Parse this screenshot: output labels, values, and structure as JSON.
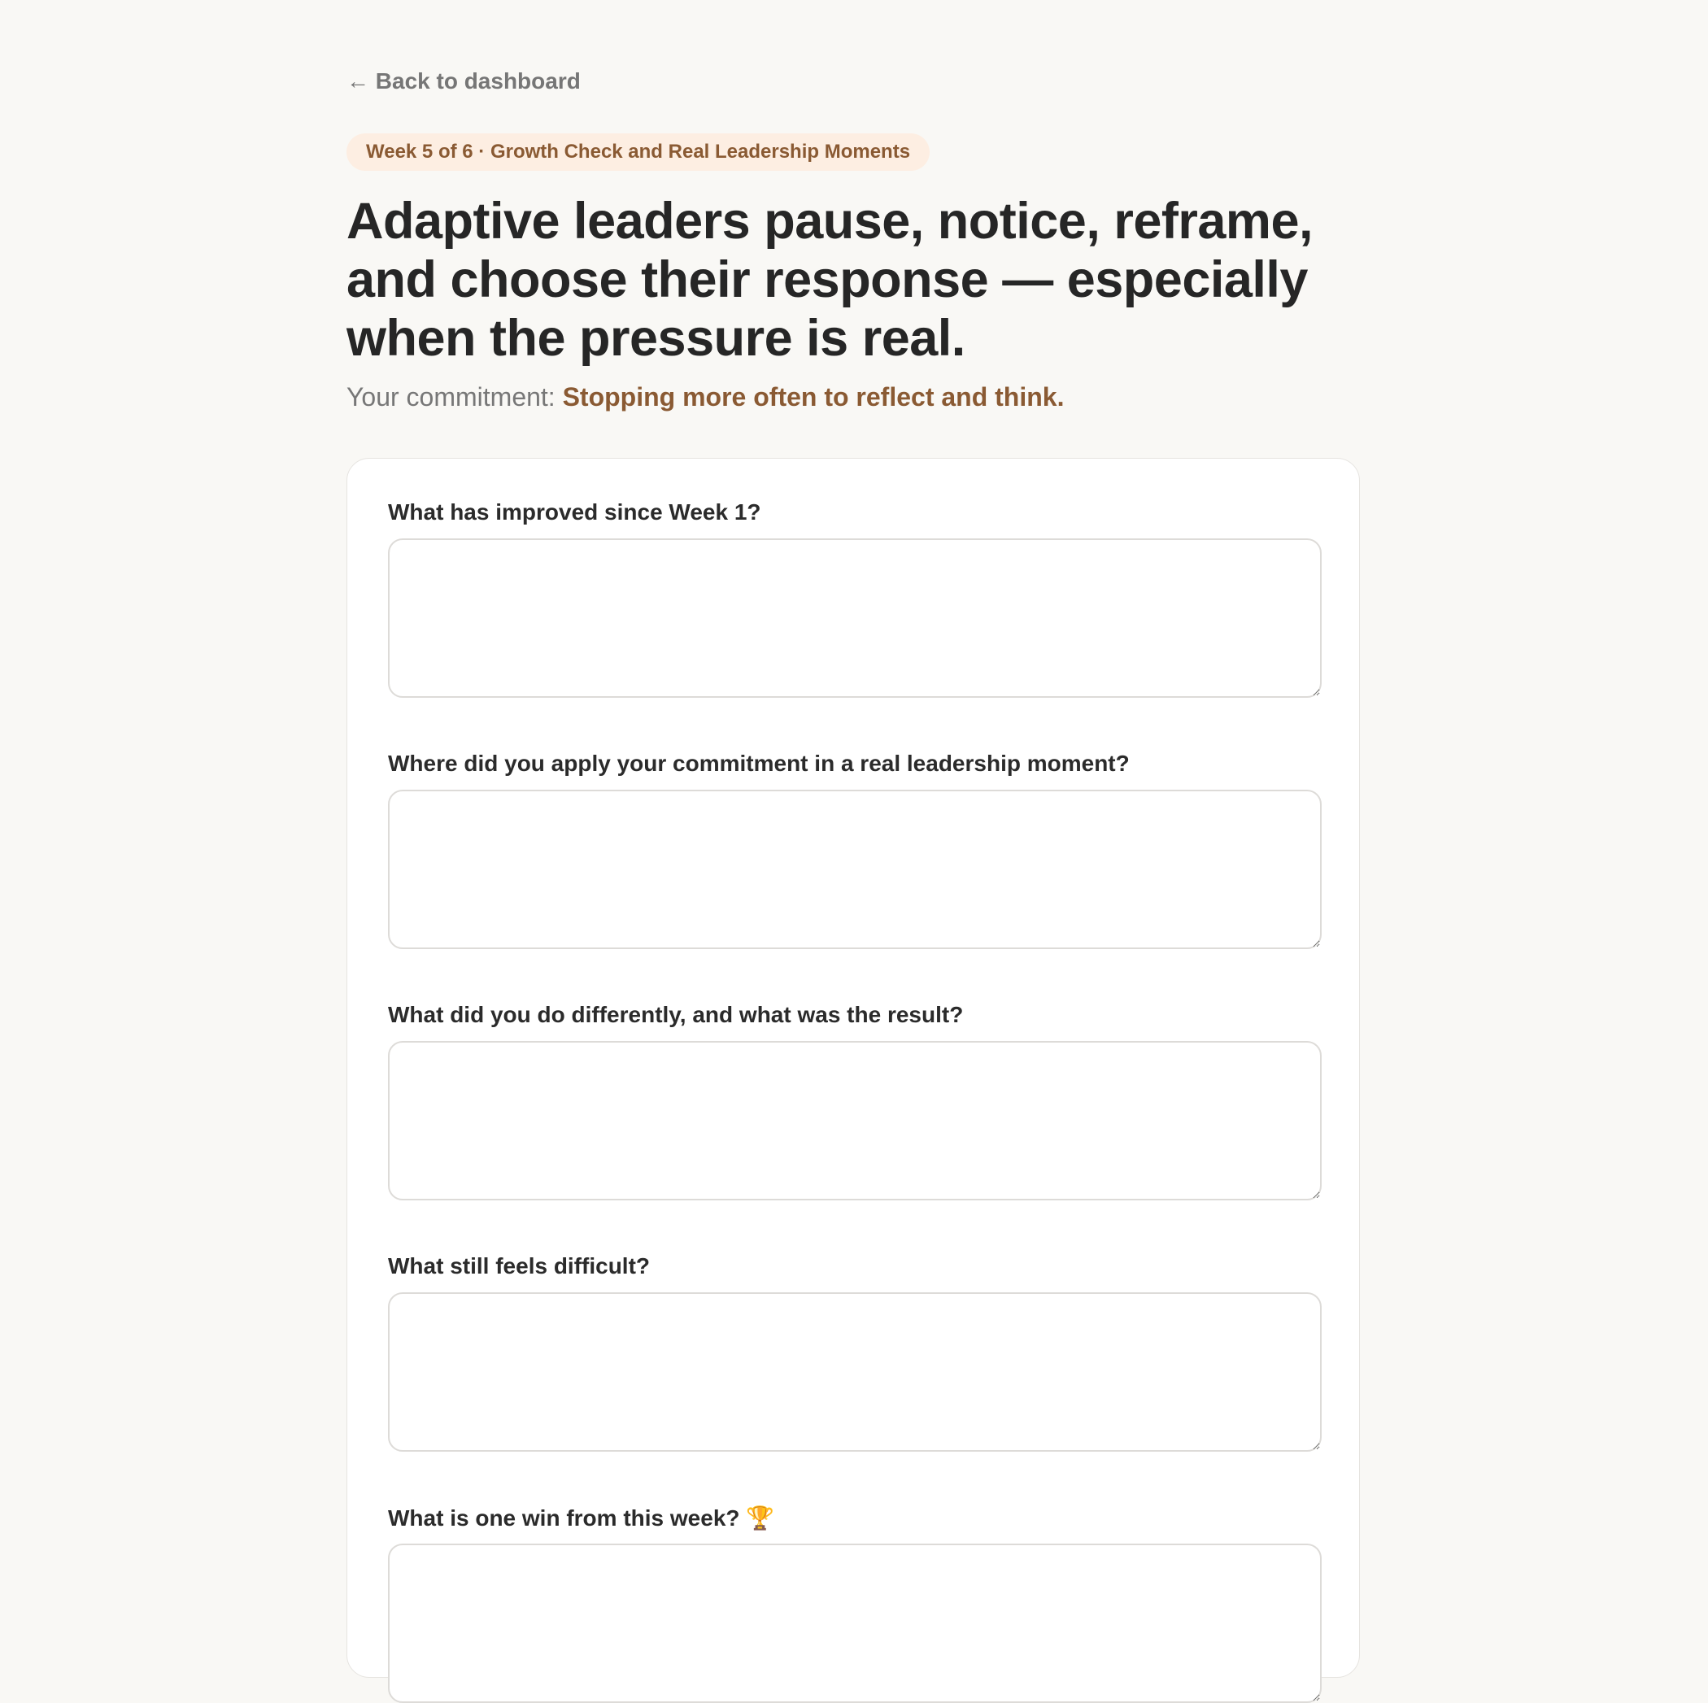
{
  "nav": {
    "back_label": "← Back to dashboard"
  },
  "badge": {
    "label": "Week 5 of 6 · Growth Check and Real Leadership Moments"
  },
  "headline": "Adaptive leaders pause, notice, reframe, and choose their response — especially when the pressure is real.",
  "commitment": {
    "label": "Your commitment:",
    "value": "Stopping more often to reflect and think."
  },
  "questions": [
    {
      "label": "What has improved since Week 1?",
      "value": "",
      "placeholder": ""
    },
    {
      "label": "Where did you apply your commitment in a real leadership moment?",
      "value": "",
      "placeholder": ""
    },
    {
      "label": "What did you do differently, and what was the result?",
      "value": "",
      "placeholder": ""
    },
    {
      "label": "What still feels difficult?",
      "value": "",
      "placeholder": ""
    },
    {
      "label": "What is one win from this week? 🏆",
      "value": "",
      "placeholder": ""
    }
  ],
  "colors": {
    "background": "#f9f8f5",
    "accent": "#8a5a33",
    "badge_background": "#fdeee2",
    "muted_text": "#767676",
    "card_background": "#ffffff",
    "border": "#dddbd8"
  }
}
